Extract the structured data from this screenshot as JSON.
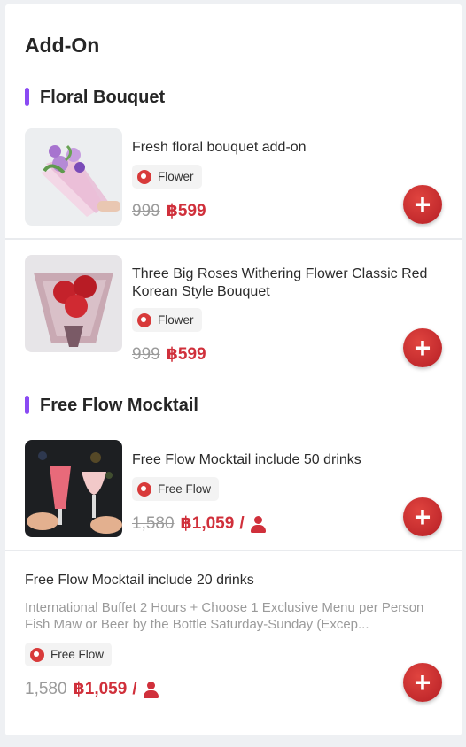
{
  "page": {
    "title": "Add-On"
  },
  "sections": [
    {
      "title": "Floral Bouquet",
      "items": [
        {
          "title": "Fresh floral bouquet add-on",
          "tag": "Flower",
          "old_price": "999",
          "new_price": "฿599",
          "add_icon": "plus-icon"
        },
        {
          "title": "Three Big Roses Withering Flower Classic Red Korean Style Bouquet",
          "tag": "Flower",
          "old_price": "999",
          "new_price": "฿599",
          "add_icon": "plus-icon"
        }
      ]
    },
    {
      "title": "Free Flow Mocktail",
      "items": [
        {
          "title": "Free Flow Mocktail include 50 drinks",
          "tag": "Free Flow",
          "old_price": "1,580",
          "new_price": "฿1,059",
          "per": "/",
          "add_icon": "plus-icon"
        },
        {
          "title": "Free Flow Mocktail include 20 drinks",
          "description": "International Buffet 2 Hours + Choose 1 Exclusive Menu per Person Fish Maw or Beer by the Bottle Saturday-Sunday (Excep...",
          "tag": "Free Flow",
          "old_price": "1,580",
          "new_price": "฿1,059",
          "per": "/",
          "add_icon": "plus-icon"
        }
      ]
    }
  ],
  "colors": {
    "accent_bar": "#8a4af3",
    "price": "#d0303b",
    "button": "#c62a2f",
    "old_price": "#9b9b9b"
  }
}
